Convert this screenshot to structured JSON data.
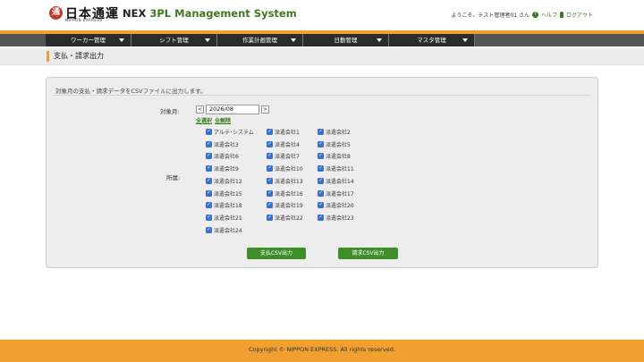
{
  "header": {
    "logo_mark": "通",
    "logo_text": "日本通運",
    "logo_sub": "NIPPON EXPRESS",
    "system_nex": "NEX",
    "system_rest": "3PL Management System",
    "welcome": "ようこそ、テスト管理者01 さん",
    "help": "ヘルプ",
    "logout": "ログアウト"
  },
  "nav": [
    "ワーカー管理",
    "シフト管理",
    "作業計画管理",
    "日勤管理",
    "マスタ管理"
  ],
  "page_title": "支払・請求出力",
  "form": {
    "description": "対象月の支払・請求データをCSVファイルに出力します。",
    "month_label": "対象月:",
    "prev": "<",
    "next": ">",
    "month_value": "2026/08",
    "select_all": "全選択",
    "deselect_all": "全解除",
    "affiliation_label": "所属:",
    "companies": [
      [
        "アルテ･システム",
        "派遣会社1",
        "派遣会社2"
      ],
      [
        "派遣会社3",
        "派遣会社4",
        "派遣会社5"
      ],
      [
        "派遣会社6",
        "派遣会社7",
        "派遣会社8"
      ],
      [
        "派遣会社9",
        "派遣会社10",
        "派遣会社11"
      ],
      [
        "派遣会社12",
        "派遣会社13",
        "派遣会社14"
      ],
      [
        "派遣会社15",
        "派遣会社16",
        "派遣会社17"
      ],
      [
        "派遣会社18",
        "派遣会社19",
        "派遣会社20"
      ],
      [
        "派遣会社21",
        "派遣会社22",
        "派遣会社23"
      ],
      [
        "派遣会社24"
      ]
    ],
    "payment_button": "支払CSV出力",
    "billing_button": "請求CSV出力"
  },
  "footer": "Copyright © NIPPON EXPRESS. All rights reserved."
}
